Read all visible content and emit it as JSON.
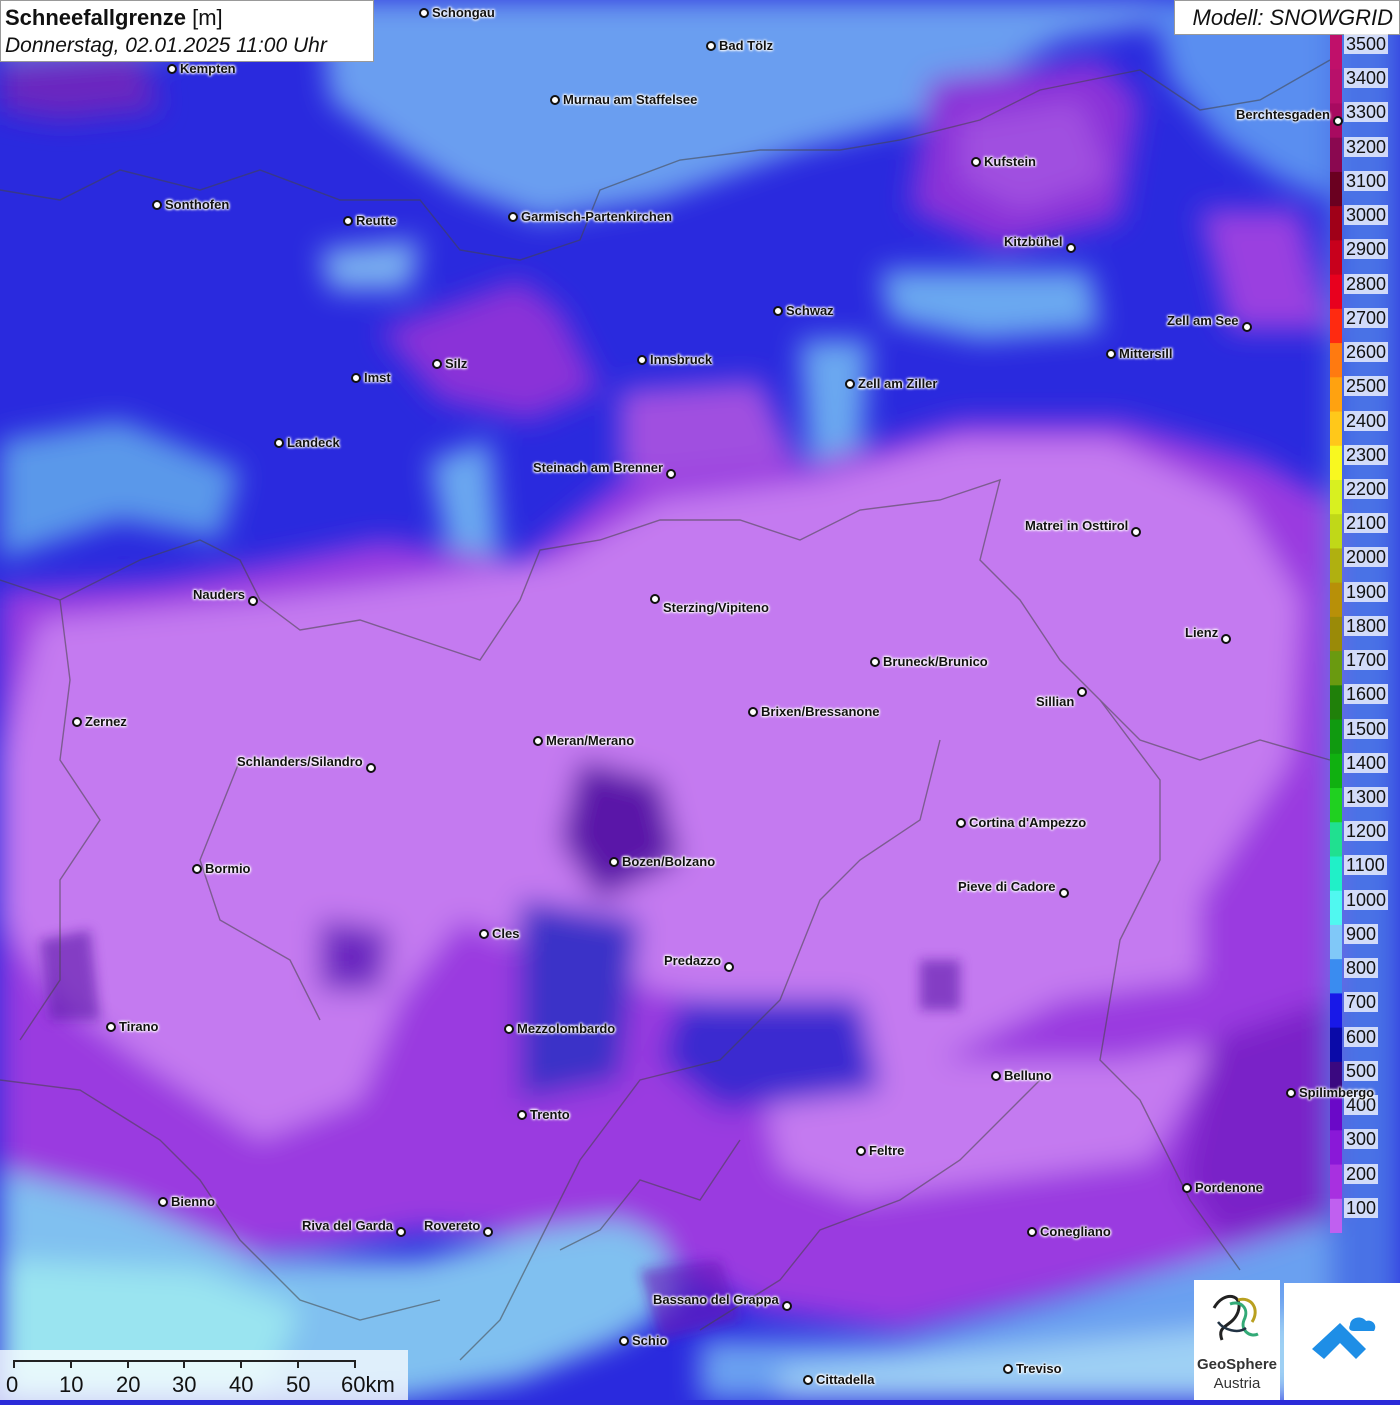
{
  "title": {
    "main": "Schneefallgrenze",
    "unit": "[m]",
    "datetime": "Donnerstag, 02.01.2025 11:00 Uhr"
  },
  "model": "Modell: SNOWGRID",
  "legend": {
    "labels": [
      "3500",
      "3400",
      "3300",
      "3200",
      "3100",
      "3000",
      "2900",
      "2800",
      "2700",
      "2600",
      "2500",
      "2400",
      "2300",
      "2200",
      "2100",
      "2000",
      "1900",
      "1800",
      "1700",
      "1600",
      "1500",
      "1400",
      "1300",
      "1200",
      "1100",
      "1000",
      "900",
      "800",
      "700",
      "600",
      "500",
      "400",
      "300",
      "200",
      "100"
    ],
    "colors": [
      "#c0106a",
      "#b8106a",
      "#a80a60",
      "#8a0850",
      "#6a0020",
      "#a00018",
      "#c8001c",
      "#e8001e",
      "#ff2a10",
      "#ff7a10",
      "#ffa210",
      "#ffc81a",
      "#f8f820",
      "#d8f020",
      "#c0d818",
      "#b0b010",
      "#b89008",
      "#9a8a08",
      "#6a9a10",
      "#20800a",
      "#109a10",
      "#10b010",
      "#20d020",
      "#20e090",
      "#20f0c8",
      "#50f8f0",
      "#80c8f8",
      "#3a8cf0",
      "#1818e8",
      "#0a0aa8",
      "#3a0880",
      "#6a08c8",
      "#8a18d8",
      "#a830e0",
      "#c060f0"
    ]
  },
  "cities": [
    {
      "name": "Schongau"
    },
    {
      "name": "Bad Tölz"
    },
    {
      "name": "Kempten"
    },
    {
      "name": "Murnau am Staffelsee"
    },
    {
      "name": "Berchtesgaden"
    },
    {
      "name": "Kufstein"
    },
    {
      "name": "Sonthofen"
    },
    {
      "name": "Reutte"
    },
    {
      "name": "Garmisch-Partenkirchen"
    },
    {
      "name": "Kitzbühel"
    },
    {
      "name": "Schwaz"
    },
    {
      "name": "Zell am See"
    },
    {
      "name": "Innsbruck"
    },
    {
      "name": "Mittersill"
    },
    {
      "name": "Silz"
    },
    {
      "name": "Imst"
    },
    {
      "name": "Zell am Ziller"
    },
    {
      "name": "Landeck"
    },
    {
      "name": "Steinach am Brenner"
    },
    {
      "name": "Matrei in Osttirol"
    },
    {
      "name": "Nauders"
    },
    {
      "name": "Sterzing/Vipiteno"
    },
    {
      "name": "Lienz"
    },
    {
      "name": "Bruneck/Brunico"
    },
    {
      "name": "Sillian"
    },
    {
      "name": "Zernez"
    },
    {
      "name": "Brixen/Bressanone"
    },
    {
      "name": "Meran/Merano"
    },
    {
      "name": "Schlanders/Silandro"
    },
    {
      "name": "Cortina d'Ampezzo"
    },
    {
      "name": "Bozen/Bolzano"
    },
    {
      "name": "Bormio"
    },
    {
      "name": "Pieve di Cadore"
    },
    {
      "name": "Cles"
    },
    {
      "name": "Predazzo"
    },
    {
      "name": "Tirano"
    },
    {
      "name": "Mezzolombardo"
    },
    {
      "name": "Belluno"
    },
    {
      "name": "Spilimbergo"
    },
    {
      "name": "Trento"
    },
    {
      "name": "Feltre"
    },
    {
      "name": "Pordenone"
    },
    {
      "name": "Bienno"
    },
    {
      "name": "Riva del Garda"
    },
    {
      "name": "Rovereto"
    },
    {
      "name": "Conegliano"
    },
    {
      "name": "Bassano del Grappa"
    },
    {
      "name": "Schio"
    },
    {
      "name": "Treviso"
    },
    {
      "name": "Cittadella"
    }
  ],
  "scale": {
    "labels": [
      "0",
      "10",
      "20",
      "30",
      "40",
      "50",
      "60km"
    ]
  },
  "logo": {
    "line1": "GeoSphere",
    "line2": "Austria"
  }
}
